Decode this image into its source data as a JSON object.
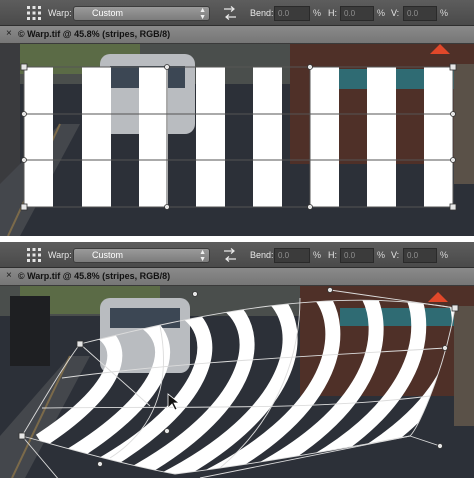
{
  "top_panel": {
    "toolbar": {
      "warp_label": "Warp:",
      "warp_style": "Custom",
      "bend_label": "Bend:",
      "bend_value": "0.0",
      "bend_unit": "%",
      "h_label": "H:",
      "h_value": "0.0",
      "h_unit": "%",
      "v_label": "V:",
      "v_value": "0.0",
      "v_unit": "%"
    },
    "document_tab": {
      "close_glyph": "×",
      "title": "© Warp.tif @ 45.8% (stripes, RGB/8)"
    },
    "icons": [
      "grid-options-icon",
      "dropdown-arrows-icon",
      "change-orientation-icon",
      "tab-close-icon"
    ]
  },
  "bottom_panel": {
    "toolbar": {
      "warp_label": "Warp:",
      "warp_style": "Custom",
      "bend_label": "Bend:",
      "bend_value": "0.0",
      "bend_unit": "%",
      "h_label": "H:",
      "h_value": "0.0",
      "h_unit": "%",
      "v_label": "V:",
      "v_value": "0.0",
      "v_unit": "%"
    },
    "document_tab": {
      "close_glyph": "×",
      "title": "© Warp.tif @ 45.8% (stripes, RGB/8)"
    },
    "icons": [
      "grid-options-icon",
      "dropdown-arrows-icon",
      "change-orientation-icon",
      "tab-close-icon",
      "move-cursor-icon"
    ]
  },
  "colors": {
    "toolbar_bg": "#4f4f4f",
    "tabbar_bg": "#7e7e7e",
    "stripe": "#ffffff",
    "warp_mesh": "#d8d8d8",
    "street": "#2c3038",
    "warning_sign": "#e0482a"
  }
}
